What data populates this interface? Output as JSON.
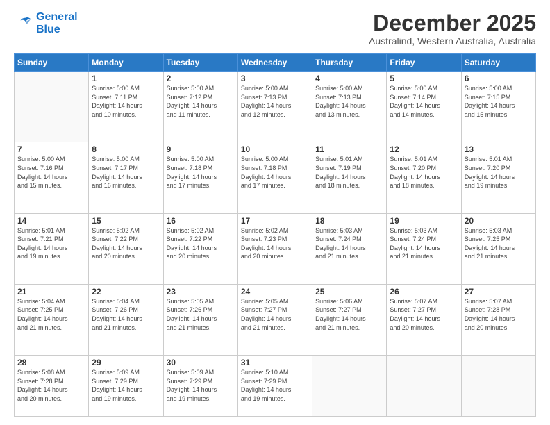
{
  "logo": {
    "line1": "General",
    "line2": "Blue"
  },
  "header": {
    "month": "December 2025",
    "location": "Australind, Western Australia, Australia"
  },
  "weekdays": [
    "Sunday",
    "Monday",
    "Tuesday",
    "Wednesday",
    "Thursday",
    "Friday",
    "Saturday"
  ],
  "weeks": [
    [
      {
        "day": "",
        "info": ""
      },
      {
        "day": "1",
        "info": "Sunrise: 5:00 AM\nSunset: 7:11 PM\nDaylight: 14 hours\nand 10 minutes."
      },
      {
        "day": "2",
        "info": "Sunrise: 5:00 AM\nSunset: 7:12 PM\nDaylight: 14 hours\nand 11 minutes."
      },
      {
        "day": "3",
        "info": "Sunrise: 5:00 AM\nSunset: 7:13 PM\nDaylight: 14 hours\nand 12 minutes."
      },
      {
        "day": "4",
        "info": "Sunrise: 5:00 AM\nSunset: 7:13 PM\nDaylight: 14 hours\nand 13 minutes."
      },
      {
        "day": "5",
        "info": "Sunrise: 5:00 AM\nSunset: 7:14 PM\nDaylight: 14 hours\nand 14 minutes."
      },
      {
        "day": "6",
        "info": "Sunrise: 5:00 AM\nSunset: 7:15 PM\nDaylight: 14 hours\nand 15 minutes."
      }
    ],
    [
      {
        "day": "7",
        "info": "Sunrise: 5:00 AM\nSunset: 7:16 PM\nDaylight: 14 hours\nand 15 minutes."
      },
      {
        "day": "8",
        "info": "Sunrise: 5:00 AM\nSunset: 7:17 PM\nDaylight: 14 hours\nand 16 minutes."
      },
      {
        "day": "9",
        "info": "Sunrise: 5:00 AM\nSunset: 7:18 PM\nDaylight: 14 hours\nand 17 minutes."
      },
      {
        "day": "10",
        "info": "Sunrise: 5:00 AM\nSunset: 7:18 PM\nDaylight: 14 hours\nand 17 minutes."
      },
      {
        "day": "11",
        "info": "Sunrise: 5:01 AM\nSunset: 7:19 PM\nDaylight: 14 hours\nand 18 minutes."
      },
      {
        "day": "12",
        "info": "Sunrise: 5:01 AM\nSunset: 7:20 PM\nDaylight: 14 hours\nand 18 minutes."
      },
      {
        "day": "13",
        "info": "Sunrise: 5:01 AM\nSunset: 7:20 PM\nDaylight: 14 hours\nand 19 minutes."
      }
    ],
    [
      {
        "day": "14",
        "info": "Sunrise: 5:01 AM\nSunset: 7:21 PM\nDaylight: 14 hours\nand 19 minutes."
      },
      {
        "day": "15",
        "info": "Sunrise: 5:02 AM\nSunset: 7:22 PM\nDaylight: 14 hours\nand 20 minutes."
      },
      {
        "day": "16",
        "info": "Sunrise: 5:02 AM\nSunset: 7:22 PM\nDaylight: 14 hours\nand 20 minutes."
      },
      {
        "day": "17",
        "info": "Sunrise: 5:02 AM\nSunset: 7:23 PM\nDaylight: 14 hours\nand 20 minutes."
      },
      {
        "day": "18",
        "info": "Sunrise: 5:03 AM\nSunset: 7:24 PM\nDaylight: 14 hours\nand 21 minutes."
      },
      {
        "day": "19",
        "info": "Sunrise: 5:03 AM\nSunset: 7:24 PM\nDaylight: 14 hours\nand 21 minutes."
      },
      {
        "day": "20",
        "info": "Sunrise: 5:03 AM\nSunset: 7:25 PM\nDaylight: 14 hours\nand 21 minutes."
      }
    ],
    [
      {
        "day": "21",
        "info": "Sunrise: 5:04 AM\nSunset: 7:25 PM\nDaylight: 14 hours\nand 21 minutes."
      },
      {
        "day": "22",
        "info": "Sunrise: 5:04 AM\nSunset: 7:26 PM\nDaylight: 14 hours\nand 21 minutes."
      },
      {
        "day": "23",
        "info": "Sunrise: 5:05 AM\nSunset: 7:26 PM\nDaylight: 14 hours\nand 21 minutes."
      },
      {
        "day": "24",
        "info": "Sunrise: 5:05 AM\nSunset: 7:27 PM\nDaylight: 14 hours\nand 21 minutes."
      },
      {
        "day": "25",
        "info": "Sunrise: 5:06 AM\nSunset: 7:27 PM\nDaylight: 14 hours\nand 21 minutes."
      },
      {
        "day": "26",
        "info": "Sunrise: 5:07 AM\nSunset: 7:27 PM\nDaylight: 14 hours\nand 20 minutes."
      },
      {
        "day": "27",
        "info": "Sunrise: 5:07 AM\nSunset: 7:28 PM\nDaylight: 14 hours\nand 20 minutes."
      }
    ],
    [
      {
        "day": "28",
        "info": "Sunrise: 5:08 AM\nSunset: 7:28 PM\nDaylight: 14 hours\nand 20 minutes."
      },
      {
        "day": "29",
        "info": "Sunrise: 5:09 AM\nSunset: 7:29 PM\nDaylight: 14 hours\nand 19 minutes."
      },
      {
        "day": "30",
        "info": "Sunrise: 5:09 AM\nSunset: 7:29 PM\nDaylight: 14 hours\nand 19 minutes."
      },
      {
        "day": "31",
        "info": "Sunrise: 5:10 AM\nSunset: 7:29 PM\nDaylight: 14 hours\nand 19 minutes."
      },
      {
        "day": "",
        "info": ""
      },
      {
        "day": "",
        "info": ""
      },
      {
        "day": "",
        "info": ""
      }
    ]
  ]
}
